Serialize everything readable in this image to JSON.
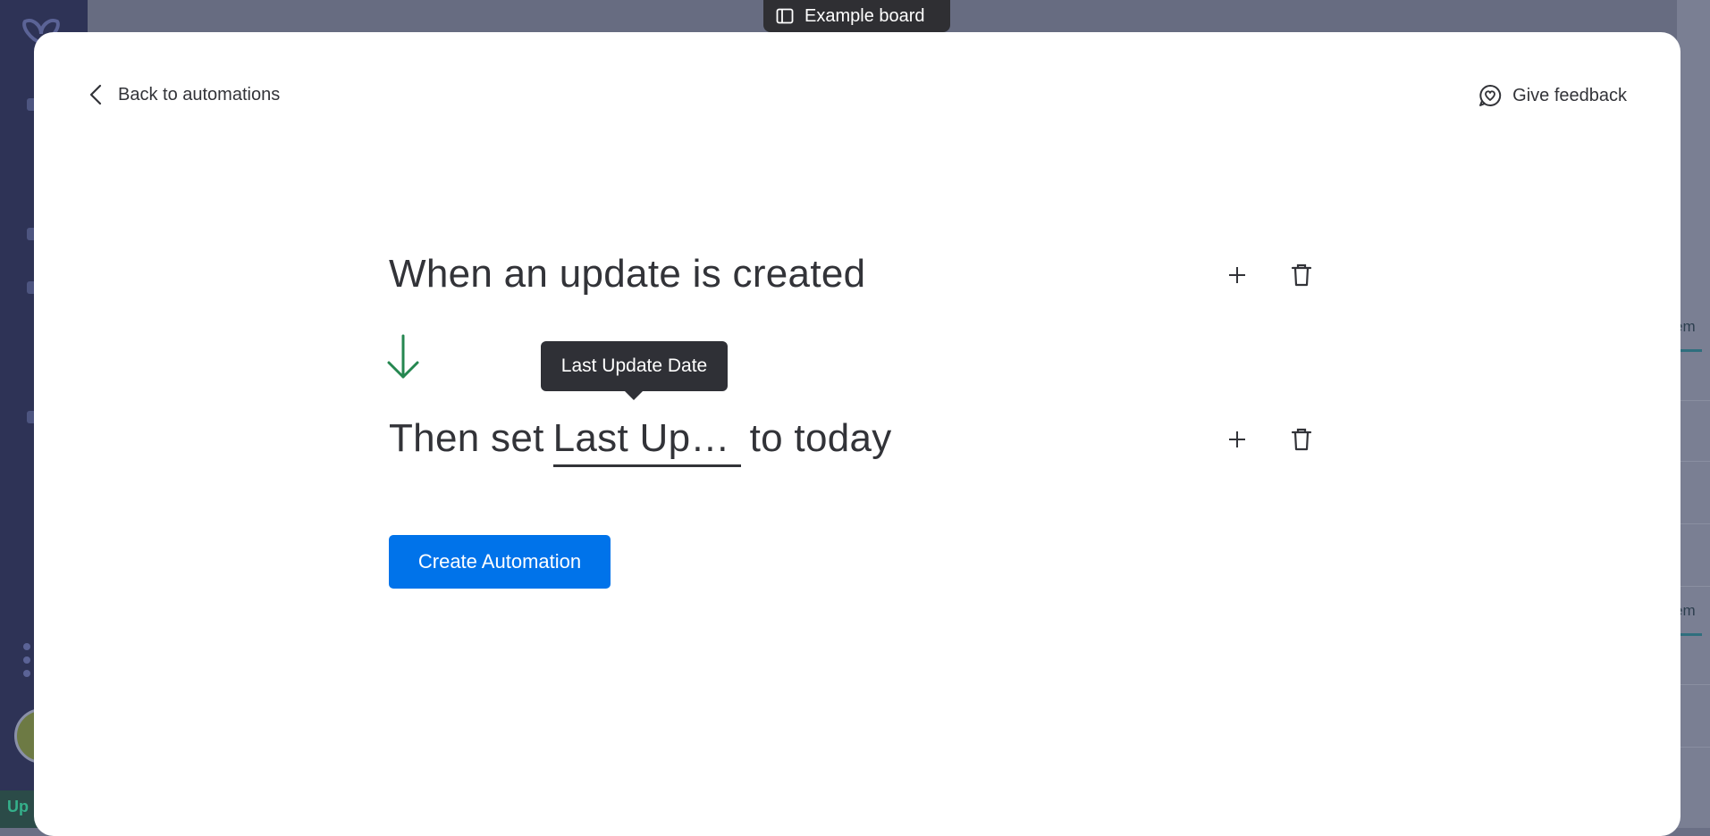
{
  "board_pill": {
    "label": "Example board",
    "icon": "sidebar-panel-icon"
  },
  "modal": {
    "back_label": "Back to automations",
    "feedback_label": "Give feedback",
    "trigger_text": "When an update is created",
    "action_prefix": "Then set",
    "action_field": "Last Upd…",
    "action_suffix": "to today",
    "tooltip": "Last Update Date",
    "create_button": "Create Automation"
  },
  "background": {
    "bottom_text": "Up",
    "right_tab_text": "em"
  },
  "colors": {
    "accent": "#0073ea",
    "arrow": "#258750",
    "tooltip_bg": "#2f3036"
  }
}
